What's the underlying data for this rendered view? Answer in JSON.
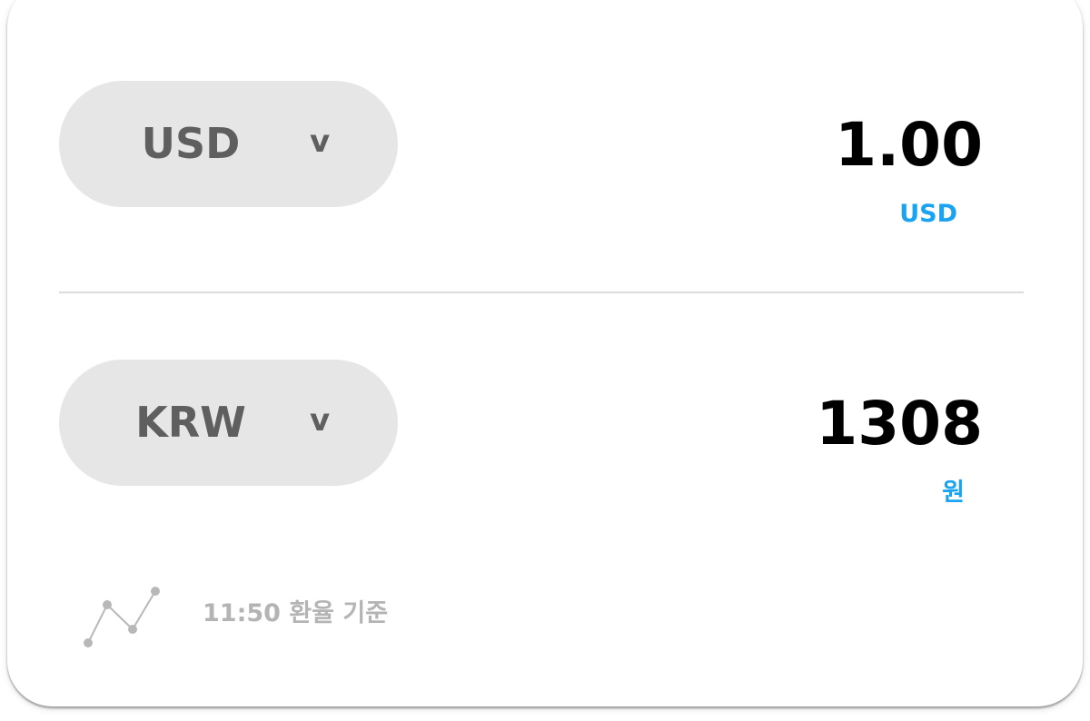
{
  "from": {
    "currency_code": "USD",
    "chevron": "v",
    "amount": "1.00",
    "unit": "USD"
  },
  "to": {
    "currency_code": "KRW",
    "chevron": "v",
    "amount": "1308",
    "unit": "원"
  },
  "footer": {
    "icon": "line-chart-icon",
    "rate_basis": "11:50 환율 기준"
  },
  "colors": {
    "card_background": "#ffffff",
    "selector_background": "#e6e6e6",
    "selector_text": "#5f5f5f",
    "amount_text": "#000000",
    "unit_accent": "#1aa3f0",
    "footer_text": "#b4b4b4",
    "divider": "#dcdcdc"
  }
}
